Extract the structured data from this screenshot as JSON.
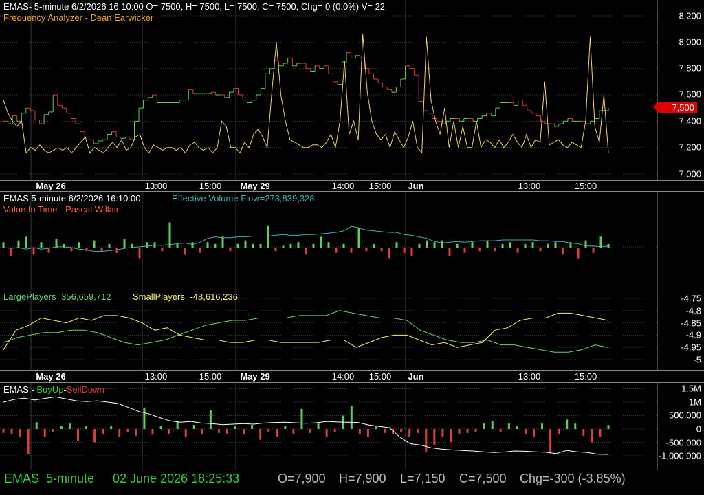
{
  "colors": {
    "bg": "#000000",
    "grid": "#3a3a3a",
    "up": "#5ccf5c",
    "down": "#e03b3b",
    "analyzer": "#f0d070",
    "flow": "#3ab3b3",
    "large": "#6cd36c",
    "small": "#f0f070",
    "buysell_line": "#ffffff",
    "footer_green": "#33cc33",
    "footer_gray": "#bbbbbb",
    "title_red": "#ff5a3a",
    "title_orange": "#e8a030"
  },
  "panel1": {
    "title": "EMAS- 5-minute 6/2/2026 16:10:00 O= 7500, H= 7500, L= 7500, C= 7500, Chg= 0 (0.0%) V= 22",
    "subtitle": "Frequency Analyzer - Dean Earwicker",
    "y_ticks": [
      "8,200",
      "8,000",
      "7,800",
      "7,600",
      "7,400",
      "7,200",
      "7,000"
    ],
    "price_flag": "7,500"
  },
  "x_axis": {
    "labels": [
      {
        "text": "May 26",
        "bold": true
      },
      {
        "text": "13:00",
        "bold": false
      },
      {
        "text": "15:00",
        "bold": false
      },
      {
        "text": "May 29",
        "bold": true
      },
      {
        "text": "14:00",
        "bold": false
      },
      {
        "text": "15:00",
        "bold": false
      },
      {
        "text": "Jun",
        "bold": true
      },
      {
        "text": "13:00",
        "bold": false
      },
      {
        "text": "15:00",
        "bold": false
      }
    ]
  },
  "panel2": {
    "title_a": "EMAS 5-minute  6/2/2026 16:10:00",
    "title_b": "Effective Volume Flow=273,839,328",
    "subtitle": "Value In Time - Pascal Willain"
  },
  "panel3": {
    "large_label": "LargePlayers=356,659,712",
    "small_label": "SmallPlayers=-48,616,236",
    "y_ticks": [
      "-4.75",
      "-4.8",
      "-4.85",
      "-4.9",
      "-4.95",
      "-5"
    ]
  },
  "panel4": {
    "title_a": "EMAS - ",
    "title_b": "BuyUp",
    "title_c": "-",
    "title_d": "SellDown",
    "y_ticks": [
      "1.5M",
      "1M",
      "500,000",
      "0",
      "-500,000",
      "-1,000,000"
    ]
  },
  "footer": {
    "symbol": "EMAS",
    "interval": "5-minute",
    "datetime": "02 June 2026 18:25:33",
    "open": "O=7,900",
    "high": "H=7,900",
    "low": "L=7,150",
    "close": "C=7,500",
    "change": "Chg=-300 (-3.85%)"
  },
  "chart_data": [
    {
      "type": "bar",
      "subtype": "ohlc-price",
      "title": "EMAS- 5-minute 6/2/2026 16:10:00 O= 7500, H= 7500, L= 7500, C= 7500, Chg= 0 (0.0%) V= 22",
      "ylim": [
        6950,
        8250
      ],
      "y_ticks": [
        7000,
        7200,
        7400,
        7600,
        7800,
        8000,
        8200
      ],
      "x_labels": [
        "May 26",
        "13:00",
        "15:00",
        "May 29",
        "14:00",
        "15:00",
        "Jun",
        "13:00",
        "15:00"
      ],
      "series": [
        {
          "name": "EMAS price",
          "values": [
            7400,
            7380,
            7440,
            7400,
            7460,
            7500,
            7480,
            7410,
            7380,
            7450,
            7470,
            7600,
            7520,
            7500,
            7460,
            7420,
            7380,
            7320,
            7280,
            7260,
            7230,
            7250,
            7260,
            7300,
            7320,
            7280,
            7270,
            7280,
            7260,
            7400,
            7500,
            7560,
            7580,
            7600,
            7540,
            7540,
            7540,
            7540,
            7540,
            7560,
            7560,
            7640,
            7610,
            7610,
            7610,
            7610,
            7620,
            7600,
            7600,
            7580,
            7620,
            7650,
            7600,
            7560,
            7540,
            7560,
            7600,
            7650,
            7760,
            7800,
            7860,
            7820,
            7840,
            7880,
            7820,
            7840,
            7840,
            7800,
            7780,
            7820,
            7800,
            7820,
            7760,
            7700,
            7680,
            7850,
            7920,
            7880,
            7900,
            7880,
            7800,
            7760,
            7720,
            7690,
            7660,
            7640,
            7620,
            7660,
            7720,
            7820,
            7800,
            7750,
            7550,
            7480,
            7460,
            7420,
            7400,
            7380,
            7400,
            7420,
            7420,
            7400,
            7420,
            7420,
            7400,
            7420,
            7440,
            7460,
            7440,
            7500,
            7540,
            7540,
            7540,
            7520,
            7560,
            7520,
            7480,
            7460,
            7440,
            7400,
            7380,
            7380,
            7360,
            7380,
            7400,
            7420,
            7400,
            7400,
            7400,
            7380,
            7400,
            7420,
            7480,
            7480,
            7500
          ]
        },
        {
          "name": "Frequency Analyzer",
          "values": [
            7560,
            7460,
            7400,
            7360,
            7400,
            7160,
            7200,
            7180,
            7220,
            7180,
            7160,
            7180,
            7200,
            7180,
            7200,
            7160,
            7200,
            7240,
            7280,
            7160,
            7200,
            7180,
            7160,
            7200,
            7240,
            7200,
            7260,
            7180,
            7200,
            7280,
            7300,
            7200,
            7160,
            7220,
            7200,
            7180,
            7200,
            7200,
            7180,
            7200,
            7160,
            7220,
            7240,
            7200,
            7180,
            7200,
            7160,
            7200,
            7400,
            7360,
            7200,
            7200,
            7160,
            7240,
            7200,
            7300,
            7340,
            7280,
            7200,
            7620,
            8000,
            7600,
            7400,
            7260,
            7240,
            7220,
            7200,
            7200,
            7220,
            7220,
            7200,
            7240,
            7300,
            7200,
            7400,
            7860,
            7300,
            7400,
            7260,
            8060,
            7620,
            7400,
            7300,
            7260,
            7300,
            7200,
            7320,
            7260,
            7200,
            7280,
            7400,
            7200,
            7160,
            8040,
            7560,
            7400,
            7300,
            7500,
            7200,
            7400,
            7200,
            7360,
            7200,
            7200,
            7400,
            7200,
            7260,
            7240,
            7200,
            7260,
            7200,
            7240,
            7300,
            7240,
            7200,
            7300,
            7200,
            7260,
            7240,
            7700,
            7220,
            7240,
            7260,
            7220,
            7200,
            7240,
            7220,
            7200,
            7400,
            8040,
            7360,
            7240,
            7600,
            7160
          ]
        }
      ]
    },
    {
      "type": "bar",
      "subtype": "volume-flow",
      "title": "EMAS 5-minute  6/2/2026 16:10:00",
      "series": [
        {
          "name": "Effective Volume Flow",
          "values": [
            0,
            -1,
            0,
            -2,
            0,
            -2,
            -1,
            1,
            1,
            0,
            -2,
            -3,
            -5,
            -5,
            -4,
            -3,
            -1,
            0,
            1,
            2,
            3,
            3,
            4,
            5,
            6,
            4,
            7,
            12,
            14,
            13,
            13,
            14,
            14,
            15,
            15,
            15,
            16,
            17,
            16,
            16,
            17,
            17,
            18,
            19,
            20,
            22,
            28,
            26,
            23,
            22,
            21,
            20,
            20,
            17,
            16,
            14,
            12,
            8,
            6,
            7,
            8,
            7,
            8,
            9,
            9,
            9,
            10,
            10,
            10,
            10,
            10,
            9,
            9,
            8,
            8,
            6,
            5,
            2,
            2,
            1,
            2
          ]
        },
        {
          "name": "Value In Time",
          "values": [
            3,
            -5,
            4,
            6,
            -4,
            3,
            -3,
            5,
            2,
            -2,
            3,
            -2,
            4,
            -2,
            2,
            -3,
            5,
            2,
            -6,
            3,
            3,
            -2,
            14,
            2,
            -4,
            3,
            -3,
            3,
            2,
            6,
            -2,
            2,
            4,
            2,
            2,
            12,
            -2,
            1,
            2,
            3,
            -4,
            2,
            6,
            3,
            -3,
            2,
            -3,
            11,
            -2,
            2,
            -2,
            -6,
            3,
            -3,
            -5,
            2,
            4,
            3,
            4,
            -5,
            2,
            -3,
            3,
            -2,
            4,
            -2,
            2,
            3,
            -3,
            2,
            3,
            -2,
            2,
            3,
            -4,
            3,
            -6,
            4,
            -3,
            6,
            2
          ]
        }
      ]
    },
    {
      "type": "line",
      "title": "",
      "ylim": [
        -5.02,
        -4.73
      ],
      "y_ticks": [
        -4.75,
        -4.8,
        -4.85,
        -4.9,
        -4.95,
        -5
      ],
      "series": [
        {
          "name": "LargePlayers",
          "values": [
            -4.93,
            -4.91,
            -4.9,
            -4.89,
            -4.89,
            -4.88,
            -4.88,
            -4.89,
            -4.91,
            -4.93,
            -4.94,
            -4.93,
            -4.92,
            -4.9,
            -4.88,
            -4.86,
            -4.85,
            -4.84,
            -4.84,
            -4.83,
            -4.83,
            -4.83,
            -4.82,
            -4.82,
            -4.82,
            -4.8,
            -4.81,
            -4.82,
            -4.83,
            -4.83,
            -4.84,
            -4.88,
            -4.9,
            -4.92,
            -4.93,
            -4.93,
            -4.92,
            -4.94,
            -4.94,
            -4.95,
            -4.96,
            -4.97,
            -4.97,
            -4.96,
            -4.94,
            -4.95
          ]
        },
        {
          "name": "SmallPlayers",
          "values": [
            -4.96,
            -4.88,
            -4.86,
            -4.83,
            -4.84,
            -4.85,
            -4.83,
            -4.84,
            -4.82,
            -4.82,
            -4.83,
            -4.85,
            -4.88,
            -4.87,
            -4.9,
            -4.91,
            -4.92,
            -4.92,
            -4.93,
            -4.93,
            -4.92,
            -4.92,
            -4.93,
            -4.93,
            -4.93,
            -4.93,
            -4.92,
            -4.92,
            -4.95,
            -4.93,
            -4.91,
            -4.9,
            -4.9,
            -4.92,
            -4.94,
            -4.93,
            -4.95,
            -4.94,
            -4.93,
            -4.88,
            -4.87,
            -4.84,
            -4.83,
            -4.83,
            -4.81,
            -4.81,
            -4.82,
            -4.83,
            -4.84
          ]
        }
      ]
    },
    {
      "type": "bar",
      "subtype": "buyup-selldown",
      "title": "EMAS - BuyUp-SellDown",
      "ylim": [
        -1050000,
        1600000
      ],
      "y_ticks": [
        1500000,
        1000000,
        500000,
        0,
        -500000,
        -1000000
      ],
      "series": [
        {
          "name": "BuyUp-SellDown cumulative",
          "values": [
            1000000,
            1100000,
            1150000,
            1080000,
            1140000,
            1200000,
            1120000,
            1050000,
            1020000,
            1050000,
            1000000,
            950000,
            800000,
            650000,
            560000,
            420000,
            300000,
            250000,
            280000,
            220000,
            200000,
            160000,
            180000,
            200000,
            180000,
            220000,
            240000,
            250000,
            230000,
            210000,
            230000,
            280000,
            260000,
            250000,
            240000,
            150000,
            100000,
            50000,
            -300000,
            -550000,
            -600000,
            -700000,
            -750000,
            -780000,
            -800000,
            -820000,
            -850000,
            -880000,
            -860000,
            -820000,
            -830000,
            -850000,
            -870000,
            -920000,
            -800000,
            -850000,
            -880000,
            -940000,
            -950000
          ]
        },
        {
          "name": "BuyUp/SellDown bars",
          "values": [
            -150000,
            -200000,
            -300000,
            -950000,
            250000,
            -300000,
            -100000,
            100000,
            200000,
            -450000,
            100000,
            -500000,
            -200000,
            100000,
            -300000,
            -100000,
            -250000,
            800000,
            -200000,
            100000,
            -200000,
            300000,
            -300000,
            150000,
            -200000,
            700000,
            -150000,
            -200000,
            100000,
            -200000,
            150000,
            -400000,
            -100000,
            -300000,
            100000,
            -200000,
            750000,
            -150000,
            200000,
            -300000,
            -100000,
            500000,
            850000,
            -200000,
            -300000,
            100000,
            -150000,
            -200000,
            -100000,
            -300000,
            -150000,
            -850000,
            -600000,
            -300000,
            -500000,
            -200000,
            -150000,
            -100000,
            200000,
            300000,
            -100000,
            200000,
            100000,
            -200000,
            -300000,
            200000,
            -900000,
            -200000,
            350000,
            200000,
            -250000,
            -500000,
            -300000,
            150000
          ]
        }
      ]
    }
  ]
}
